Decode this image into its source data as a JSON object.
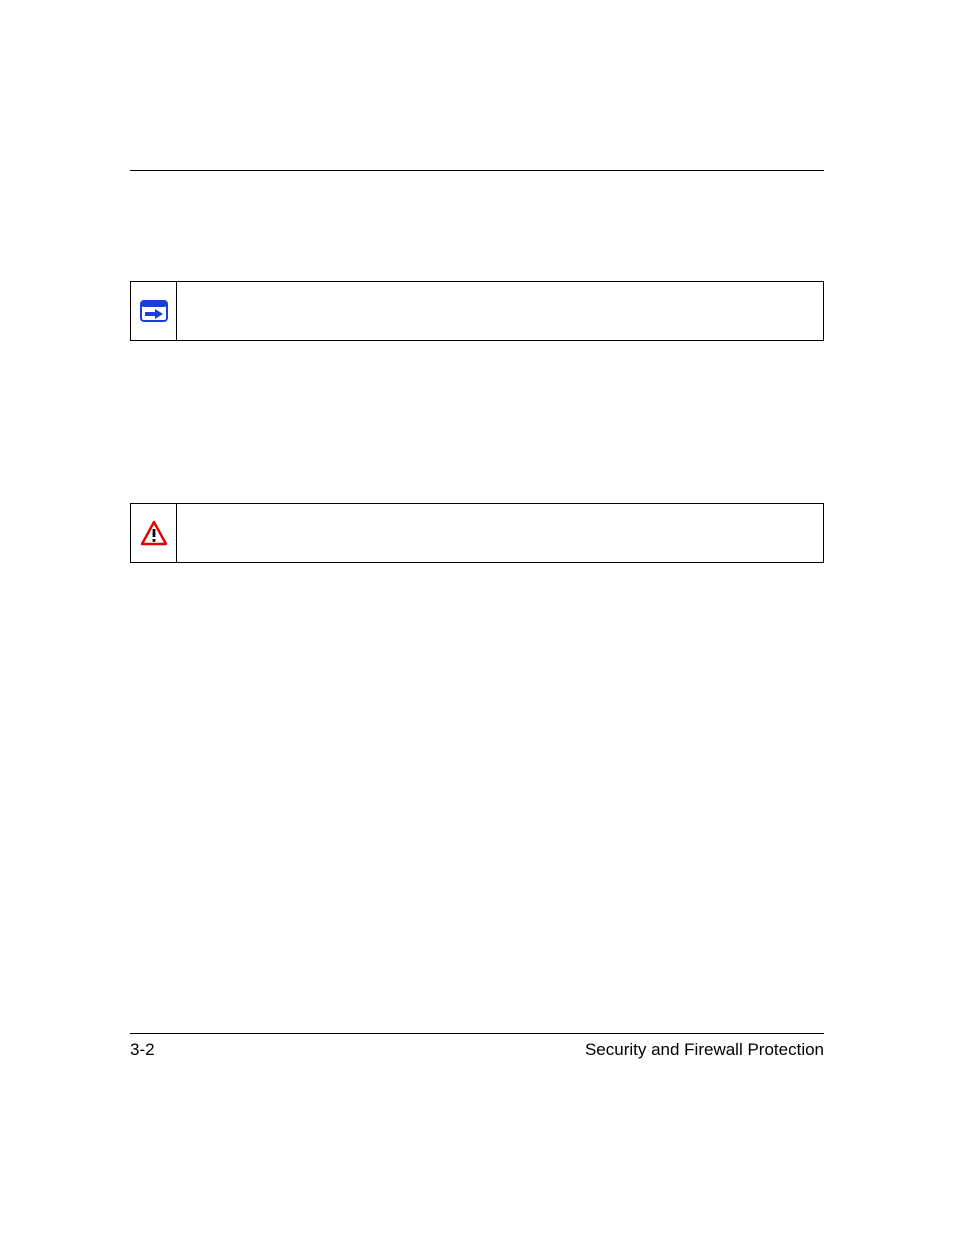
{
  "footer": {
    "page_number": "3-2",
    "section_title": "Security and Firewall Protection"
  },
  "callouts": {
    "note": {
      "icon_name": "arrow-right-icon"
    },
    "warning": {
      "icon_name": "warning-icon"
    }
  }
}
